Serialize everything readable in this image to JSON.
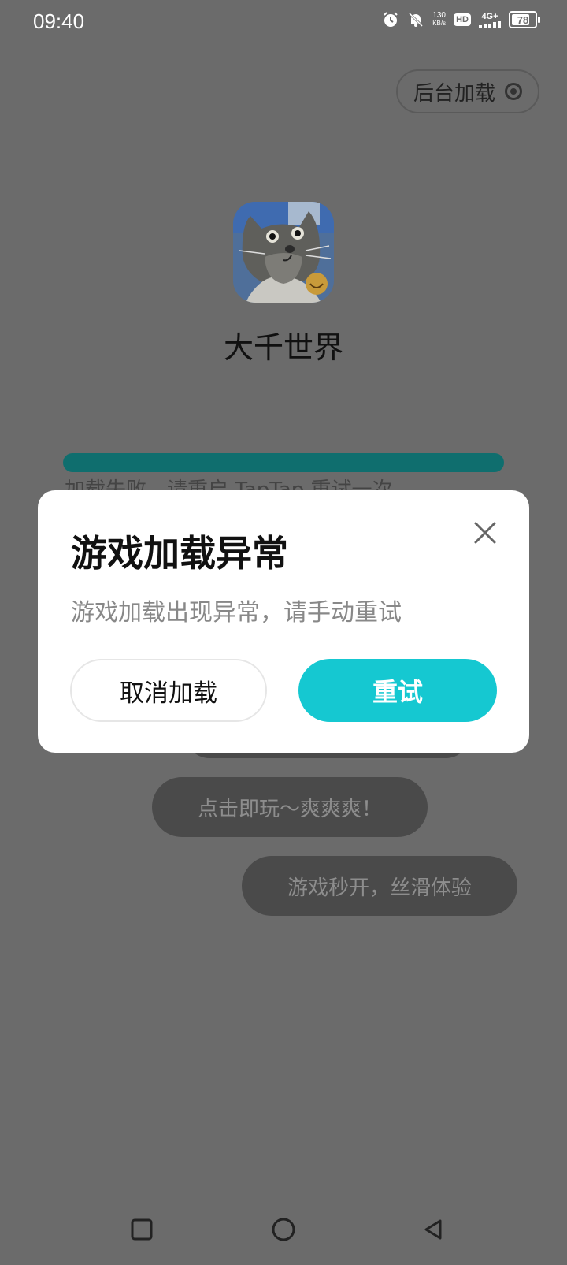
{
  "status_bar": {
    "time": "09:40",
    "net_speed_value": "130",
    "net_speed_unit": "KB/s",
    "hd_label": "HD",
    "signal_label": "4G+",
    "battery_percent": "78",
    "battery_level": 0.78
  },
  "header": {
    "background_load_label": "后台加载"
  },
  "app": {
    "name": "大千世界",
    "progress_fraction": 1.0,
    "error_text": "加载失败，请重启 TapTap 重试一次"
  },
  "bubbles": {
    "hidden": "",
    "item_1": "点击即玩～爽爽爽！",
    "item_2": "游戏秒开，丝滑体验"
  },
  "dialog": {
    "title": "游戏加载异常",
    "message": "游戏加载出现异常，请手动重试",
    "cancel_label": "取消加载",
    "retry_label": "重试"
  },
  "colors": {
    "accent": "#15c8d1",
    "progress": "#0f6e6e",
    "overlay_bg": "#6b6b6b"
  },
  "icons": {
    "close": "close-icon",
    "target": "target-icon",
    "nav_recent": "square-icon",
    "nav_home": "circle-icon",
    "nav_back": "triangle-back-icon"
  }
}
